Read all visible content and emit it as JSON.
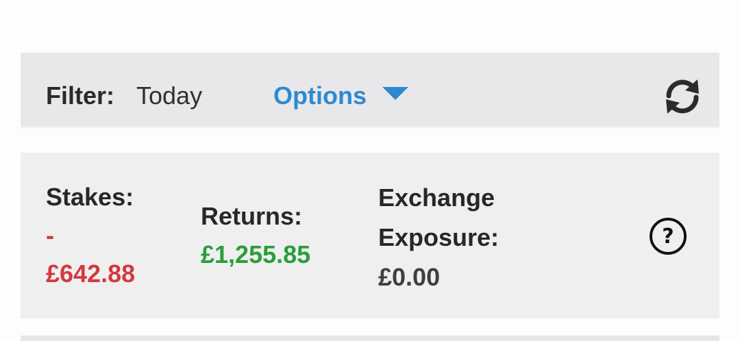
{
  "filter_bar": {
    "label": "Filter:",
    "value": "Today",
    "options_label": "Options",
    "refresh_icon": "refresh-icon",
    "caret_icon": "caret-down-icon"
  },
  "summary": {
    "stakes_label": "Stakes:",
    "stakes_sign": "-",
    "stakes_value": "£642.88",
    "returns_label": "Returns:",
    "returns_value": "£1,255.85",
    "exposure_label_line1": "Exchange",
    "exposure_label_line2": "Exposure:",
    "exposure_value": "£0.00",
    "help_icon": "help-icon",
    "help_glyph": "?"
  },
  "colors": {
    "accent": "#2d8ad0",
    "negative": "#d23a3f",
    "positive": "#2a9e3a"
  }
}
